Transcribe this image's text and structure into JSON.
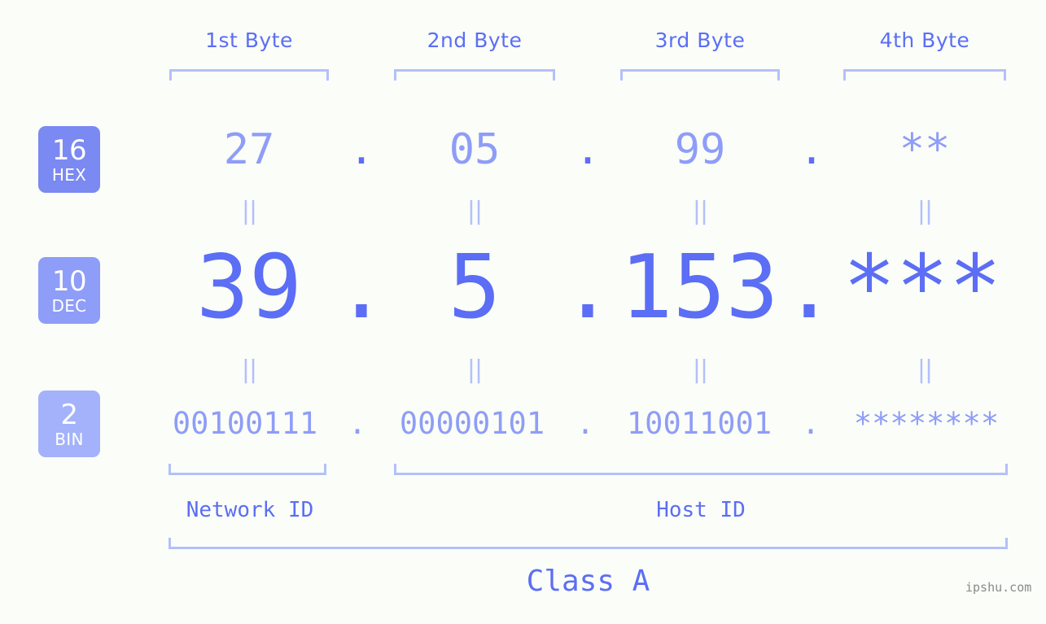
{
  "colors": {
    "background": "#fbfdf8",
    "accent_strong": "#5b6ef5",
    "accent_mid": "#8e9df7",
    "accent_light": "#b4c0fb",
    "badge_hex": "#7b89f2",
    "badge_dec": "#8e9df7",
    "badge_bin": "#a3b2fb",
    "watermark": "#8a8a8a"
  },
  "byte_headers": [
    {
      "label": "1st Byte"
    },
    {
      "label": "2nd Byte"
    },
    {
      "label": "3rd Byte"
    },
    {
      "label": "4th Byte"
    }
  ],
  "bases": [
    {
      "number": "16",
      "name": "HEX"
    },
    {
      "number": "10",
      "name": "DEC"
    },
    {
      "number": "2",
      "name": "BIN"
    }
  ],
  "rows": {
    "hex": {
      "base_number": "16",
      "base_name": "HEX",
      "values": [
        "27",
        "05",
        "99",
        "**"
      ],
      "separator": "."
    },
    "dec": {
      "base_number": "10",
      "base_name": "DEC",
      "values": [
        "39",
        "5",
        "153",
        "***"
      ],
      "separator": "."
    },
    "bin": {
      "base_number": "2",
      "base_name": "BIN",
      "values": [
        "00100111",
        "00000101",
        "10011001",
        "********"
      ],
      "separator": "."
    }
  },
  "equals_marks": {
    "glyph": "||",
    "count_per_row": 4
  },
  "segments": {
    "network_id": "Network ID",
    "host_id": "Host ID",
    "class": "Class A"
  },
  "watermark": "ipshu.com"
}
